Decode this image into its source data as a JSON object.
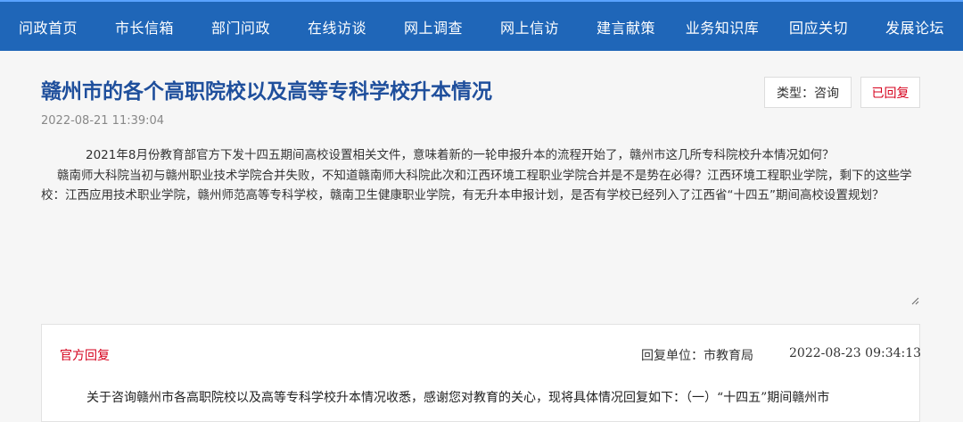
{
  "nav": {
    "items": [
      "问政首页",
      "市长信箱",
      "部门问政",
      "在线访谈",
      "网上调查",
      "网上信访",
      "建言献策",
      "业务知识库",
      "回应关切",
      "发展论坛"
    ]
  },
  "article": {
    "title": "赣州市的各个高职院校以及高等专科学校升本情况",
    "date": "2022-08-21 11:39:04",
    "type_tag": "类型：咨询",
    "status_tag": "已回复",
    "paragraphs": [
      "2021年8月份教育部官方下发十四五期间高校设置相关文件，意味着新的一轮申报升本的流程开始了，赣州市这几所专科院校升本情况如何？",
      "赣南师大科院当初与赣州职业技术学院合并失败，不知道赣南师大科院此次和江西环境工程职业学院合并是不是势在必得？江西环境工程职业学院，剩下的这些学校：江西应用技术职业学院，赣州师范高等专科学校，赣南卫生健康职业学院，有无升本申报计划，是否有学校已经列入了江西省“十四五”期间高校设置规划？"
    ]
  },
  "reply": {
    "label": "官方回复",
    "unit": "回复单位：市教育局",
    "date": "2022-08-23 09:34:13",
    "body": "关于咨询赣州市各高职院校以及高等专科学校升本情况收悉，感谢您对教育的关心，现将具体情况回复如下：（一）“十四五”期间赣州市"
  },
  "colors": {
    "nav_bg": "#1f66b8",
    "title": "#1f4f9c",
    "accent_red": "#d6001c"
  }
}
